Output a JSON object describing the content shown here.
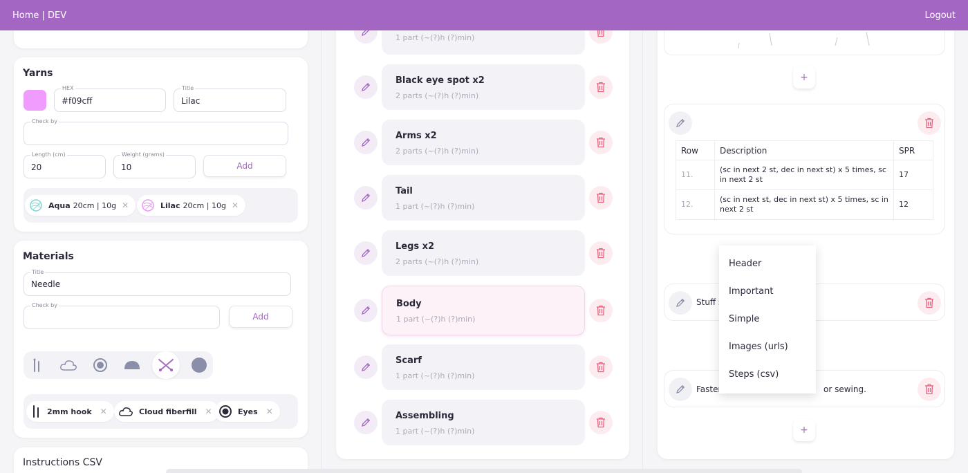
{
  "nav": {
    "home": "Home | DEV",
    "logout": "Logout"
  },
  "yarns": {
    "title": "Yarns",
    "swatch_color": "#f09cff",
    "hex_label": "HEX",
    "hex_value": "#f09cff",
    "title_label": "Title",
    "title_value": "Lilac",
    "check_label": "Check by",
    "length_label": "Length (cm)",
    "length_value": "20",
    "weight_label": "Weight (grams)",
    "weight_value": "10",
    "add_label": "Add",
    "chips": [
      {
        "name": "Aqua",
        "detail": "20cm | 10g",
        "color": "#7fd6cf"
      },
      {
        "name": "Lilac",
        "detail": "20cm | 10g",
        "color": "#e49cf0"
      }
    ]
  },
  "materials": {
    "title": "Materials",
    "title_label": "Title",
    "title_value": "Needle",
    "check_label": "Check by",
    "add_label": "Add",
    "chips": [
      {
        "name": "2mm hook"
      },
      {
        "name": "Cloud fiberfill"
      },
      {
        "name": "Eyes"
      }
    ]
  },
  "instructions": {
    "title": "Instructions CSV"
  },
  "parts": [
    {
      "title": "",
      "subtitle": "1 part (~(?)h (?)min)"
    },
    {
      "title": "Black eye spot x2",
      "subtitle": "2 parts (~(?)h (?)min)"
    },
    {
      "title": "Arms x2",
      "subtitle": "2 parts (~(?)h (?)min)"
    },
    {
      "title": "Tail",
      "subtitle": "1 part (~(?)h (?)min)"
    },
    {
      "title": "Legs x2",
      "subtitle": "2 parts (~(?)h (?)min)"
    },
    {
      "title": "Body",
      "subtitle": "1 part (~(?)h (?)min)"
    },
    {
      "title": "Scarf",
      "subtitle": "1 part (~(?)h (?)min)"
    },
    {
      "title": "Assembling",
      "subtitle": "1 part (~(?)h (?)min)"
    }
  ],
  "steps_table": {
    "headers": [
      "Row",
      "Description",
      "SPR"
    ],
    "rows": [
      {
        "row": "11.",
        "desc": "(sc in next 2 st, dec in next st) x 5 times, sc in next 2 st",
        "spr": "17"
      },
      {
        "row": "12.",
        "desc": "(sc in next st, dec in next st) x 5 times, sc in next 2 st",
        "spr": "12"
      }
    ]
  },
  "simple_steps": {
    "stuff_text": "Stuff s",
    "fasten_left": "Fasten",
    "fasten_right": "or sewing."
  },
  "add_symbol": "+",
  "dropdown": {
    "items": [
      "Header",
      "Important",
      "Simple",
      "Images (urls)",
      "Steps (csv)"
    ]
  },
  "colors": {
    "accent": "#a466c3",
    "danger": "#e8607e"
  }
}
